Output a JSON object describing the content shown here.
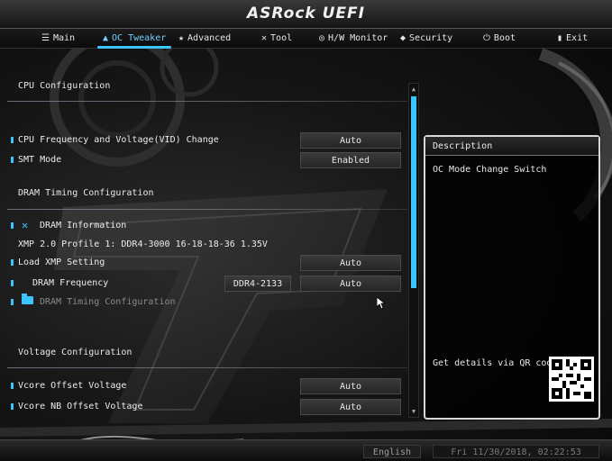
{
  "brand": {
    "title": "ASRock UEFI"
  },
  "nav": [
    {
      "label": "Main",
      "icon": "list-icon",
      "glyph": "☰"
    },
    {
      "label": "OC Tweaker",
      "icon": "flame-icon",
      "glyph": "▲"
    },
    {
      "label": "Advanced",
      "icon": "star-icon",
      "glyph": "★"
    },
    {
      "label": "Tool",
      "icon": "tool-icon",
      "glyph": "✕"
    },
    {
      "label": "H/W Monitor",
      "icon": "monitor-icon",
      "glyph": "◎"
    },
    {
      "label": "Security",
      "icon": "shield-icon",
      "glyph": "◆"
    },
    {
      "label": "Boot",
      "icon": "power-icon",
      "glyph": "⏻"
    },
    {
      "label": "Exit",
      "icon": "exit-icon",
      "glyph": "▮"
    }
  ],
  "active_tab": "OC Tweaker",
  "sections": {
    "cpu": "CPU Configuration",
    "dram": "DRAM Timing Configuration",
    "voltage": "Voltage Configuration"
  },
  "items": {
    "cpu_freq": {
      "label": "CPU Frequency and Voltage(VID) Change",
      "value": "Auto"
    },
    "smt": {
      "label": "SMT Mode",
      "value": "Enabled"
    },
    "dram_info": {
      "label": "DRAM Information"
    },
    "xmp_profile": {
      "label": "XMP 2.0 Profile 1: DDR4-3000 16-18-18-36 1.35V"
    },
    "load_xmp": {
      "label": "Load XMP Setting",
      "value": "Auto"
    },
    "dram_freq": {
      "label": "DRAM Frequency",
      "current": "DDR4-2133",
      "value": "Auto"
    },
    "dram_timing": {
      "label": "DRAM Timing Configuration"
    },
    "vcore_offset": {
      "label": "Vcore Offset Voltage",
      "value": "Auto"
    },
    "vcore_nb_offset": {
      "label": "Vcore NB Offset Voltage",
      "value": "Auto"
    }
  },
  "description": {
    "title": "Description",
    "text": "OC Mode Change Switch",
    "qr_text": "Get details via QR code"
  },
  "footer": {
    "language": "English",
    "datetime": "Fri 11/30/2018, 02:22:53"
  },
  "colors": {
    "accent": "#3cc4ff",
    "background": "#111111"
  }
}
